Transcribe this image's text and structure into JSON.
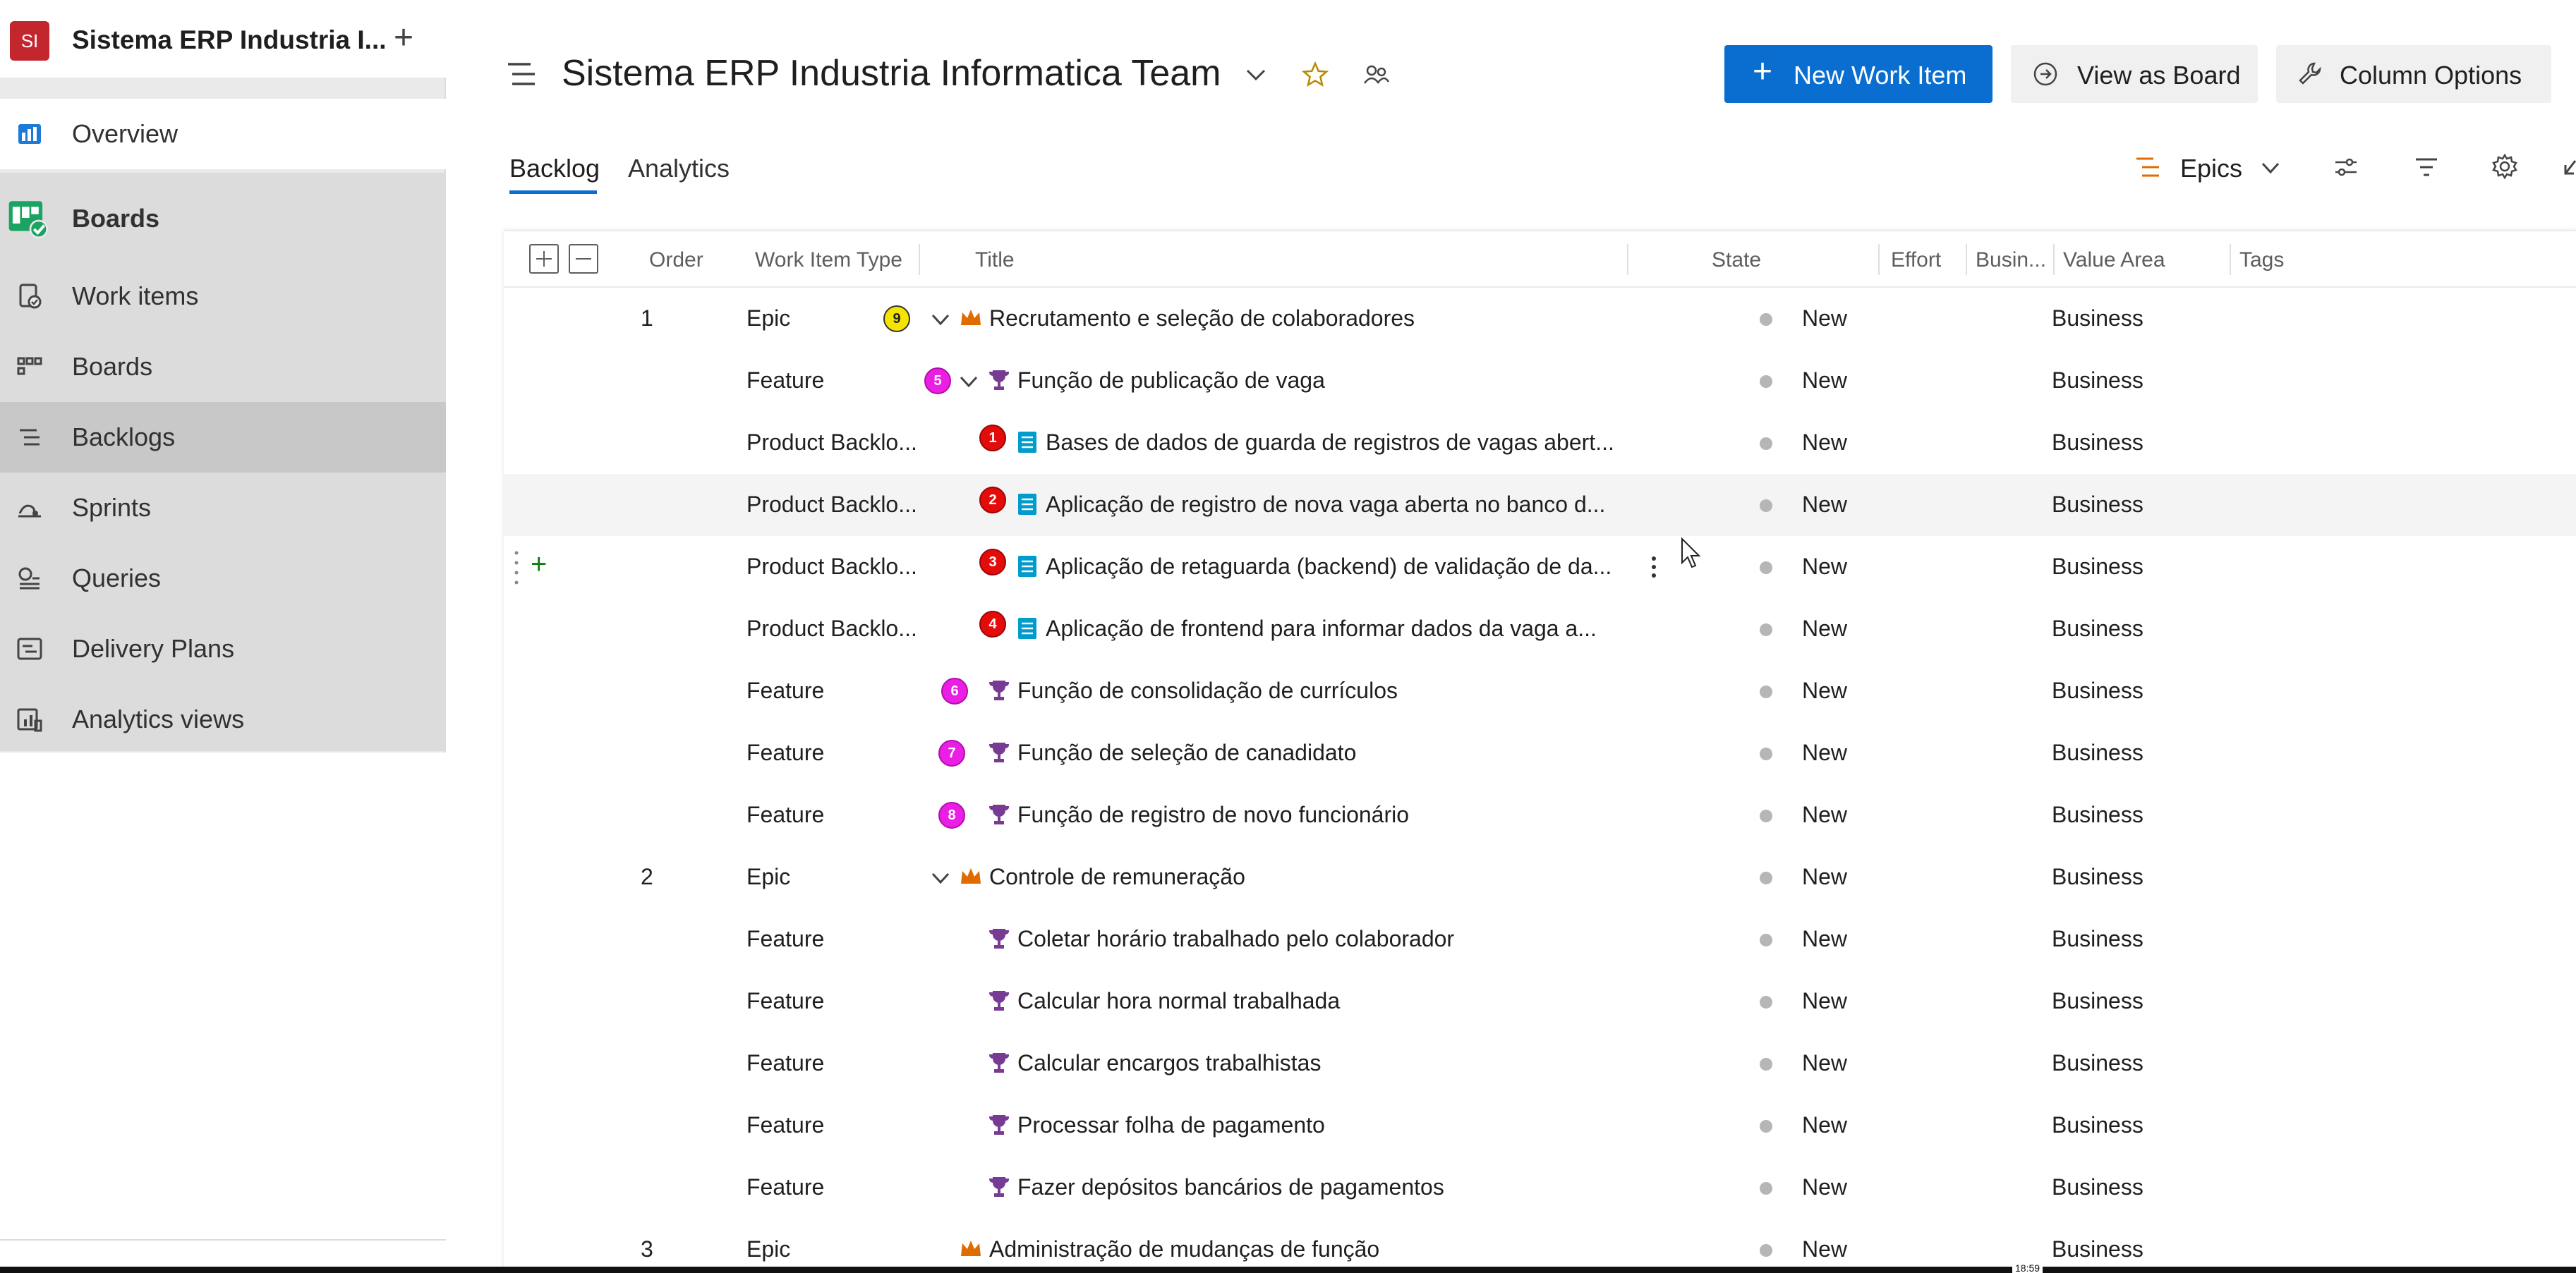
{
  "sidebar": {
    "project_initials": "SI",
    "project_name": "Sistema ERP Industria I...",
    "items": {
      "overview": "Overview",
      "boards_section": "Boards",
      "work_items": "Work items",
      "boards": "Boards",
      "backlogs": "Backlogs",
      "sprints": "Sprints",
      "queries": "Queries",
      "delivery_plans": "Delivery Plans",
      "analytics_views": "Analytics views"
    }
  },
  "header": {
    "team_title": "Sistema ERP Industria Informatica Team",
    "new_work_item": "New Work Item",
    "view_as_board": "View as Board",
    "column_options": "Column Options"
  },
  "tabs": {
    "backlog": "Backlog",
    "analytics": "Analytics",
    "level": "Epics"
  },
  "columns": {
    "order": "Order",
    "work_item_type": "Work Item Type",
    "title": "Title",
    "state": "State",
    "effort": "Effort",
    "business_value": "Busin...",
    "value_area": "Value Area",
    "tags": "Tags"
  },
  "rows": [
    {
      "order": "1",
      "type": "Epic",
      "title": "Recrutamento e seleção de colaboradores",
      "state": "New",
      "value_area": "Business",
      "badge": "9"
    },
    {
      "order": "",
      "type": "Feature",
      "title": "Função de publicação de vaga",
      "state": "New",
      "value_area": "Business",
      "badge": "5"
    },
    {
      "order": "",
      "type": "Product Backlo...",
      "title": "Bases de dados de guarda de registros de vagas abert...",
      "state": "New",
      "value_area": "Business",
      "badge": "1"
    },
    {
      "order": "",
      "type": "Product Backlo...",
      "title": "Aplicação de registro de nova vaga aberta no banco d...",
      "state": "New",
      "value_area": "Business",
      "badge": "2"
    },
    {
      "order": "",
      "type": "Product Backlo...",
      "title": "Aplicação de retaguarda (backend) de validação de da...",
      "state": "New",
      "value_area": "Business",
      "badge": "3"
    },
    {
      "order": "",
      "type": "Product Backlo...",
      "title": "Aplicação de frontend para informar dados da vaga a...",
      "state": "New",
      "value_area": "Business",
      "badge": "4"
    },
    {
      "order": "",
      "type": "Feature",
      "title": "Função de consolidação de currículos",
      "state": "New",
      "value_area": "Business",
      "badge": "6"
    },
    {
      "order": "",
      "type": "Feature",
      "title": "Função de seleção de canadidato",
      "state": "New",
      "value_area": "Business",
      "badge": "7"
    },
    {
      "order": "",
      "type": "Feature",
      "title": "Função de registro de novo funcionário",
      "state": "New",
      "value_area": "Business",
      "badge": "8"
    },
    {
      "order": "2",
      "type": "Epic",
      "title": "Controle de remuneração",
      "state": "New",
      "value_area": "Business"
    },
    {
      "order": "",
      "type": "Feature",
      "title": "Coletar horário trabalhado pelo colaborador",
      "state": "New",
      "value_area": "Business"
    },
    {
      "order": "",
      "type": "Feature",
      "title": "Calcular hora normal trabalhada",
      "state": "New",
      "value_area": "Business"
    },
    {
      "order": "",
      "type": "Feature",
      "title": "Calcular encargos trabalhistas",
      "state": "New",
      "value_area": "Business"
    },
    {
      "order": "",
      "type": "Feature",
      "title": "Processar folha de pagamento",
      "state": "New",
      "value_area": "Business"
    },
    {
      "order": "",
      "type": "Feature",
      "title": "Fazer depósitos bancários de pagamentos",
      "state": "New",
      "value_area": "Business"
    },
    {
      "order": "3",
      "type": "Epic",
      "title": "Administração de mudanças de função",
      "state": "New",
      "value_area": "Business"
    }
  ],
  "colors": {
    "accent": "#0a6ed1",
    "epic": "#e06c00",
    "feature": "#773b93",
    "pbi": "#009ccc"
  },
  "status_time": "18:59"
}
